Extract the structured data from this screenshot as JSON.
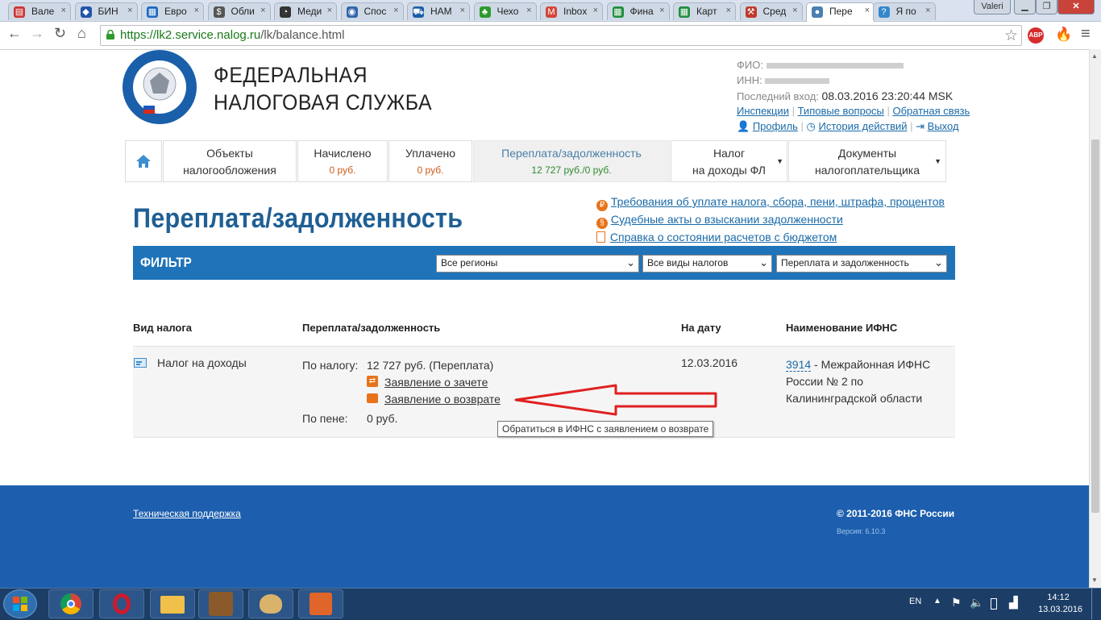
{
  "browser": {
    "tabs": [
      {
        "label": "Вале",
        "icon_color": "#cc3333",
        "icon": "flag-ru"
      },
      {
        "label": "БИН",
        "icon_color": "#2255aa",
        "icon": "diamond"
      },
      {
        "label": "Евро",
        "icon_color": "#1a6ac0",
        "icon": "grid"
      },
      {
        "label": "Обли",
        "icon_color": "#555555",
        "icon": "money"
      },
      {
        "label": "Меди",
        "icon_color": "#333333",
        "icon": "spiral"
      },
      {
        "label": "Спос",
        "icon_color": "#3366aa",
        "icon": "globe"
      },
      {
        "label": "НАМ",
        "icon_color": "#1a5faa",
        "icon": "cart"
      },
      {
        "label": "Чехо",
        "icon_color": "#2e9a2e",
        "icon": "clover"
      },
      {
        "label": "Inbox",
        "icon_color": "#d44638",
        "icon": "gmail"
      },
      {
        "label": "Фина",
        "icon_color": "#1e8e3e",
        "icon": "sheet"
      },
      {
        "label": "Карт",
        "icon_color": "#1e8e3e",
        "icon": "sheet"
      },
      {
        "label": "Сред",
        "icon_color": "#c0392b",
        "icon": "tool"
      },
      {
        "label": "Пере",
        "icon_color": "#4a7fb0",
        "icon": "fns",
        "active": true
      },
      {
        "label": "Я по",
        "icon_color": "#3388cc",
        "icon": "help"
      }
    ],
    "user_badge": "Valeri",
    "url_scheme": "https://",
    "url_host": "lk2.service.nalog.ru",
    "url_path": "/lk/balance.html",
    "abp_label": "ABP"
  },
  "header": {
    "org_line1": "ФЕДЕРАЛЬНАЯ",
    "org_line2": "НАЛОГОВАЯ СЛУЖБА",
    "fio_label": "ФИО:",
    "inn_label": "ИНН:",
    "last_login_label": "Последний вход:",
    "last_login_value": "08.03.2016 23:20:44 MSK",
    "links": [
      "Инспекции",
      "Типовые вопросы",
      "Обратная связь"
    ],
    "profile": "Профиль",
    "history": "История действий",
    "logout": "Выход"
  },
  "nav": [
    {
      "line1": "Объекты",
      "line2": "налогообложения"
    },
    {
      "line1": "Начислено",
      "sub": "0 руб."
    },
    {
      "line1": "Уплачено",
      "sub": "0 руб."
    },
    {
      "line1": "Переплата/задолженность",
      "sub": "12 727 руб./0 руб.",
      "active": true
    },
    {
      "line1": "Налог",
      "line2": "на доходы ФЛ"
    },
    {
      "line1": "Документы",
      "line2": "налогоплательщика"
    }
  ],
  "page": {
    "title": "Переплата/задолженность",
    "side_links": [
      "Требования об уплате налога, сбора, пени, штрафа, процентов",
      "Судебные акты о взыскании задолженности",
      "Справка о состоянии расчетов с бюджетом"
    ],
    "filter_label": "ФИЛЬТР",
    "filter_region": "Все регионы",
    "filter_tax": "Все виды налогов",
    "filter_kind": "Переплата и задолженность"
  },
  "table": {
    "headers": [
      "Вид налога",
      "Переплата/задолженность",
      "На дату",
      "Наименование ИФНС"
    ],
    "row": {
      "tax": "Налог на доходы",
      "by_tax_label": "По налогу:",
      "by_tax_value": "12 727 руб. (Переплата)",
      "offset_link": "Заявление о зачете",
      "refund_link": "Заявление о возврате",
      "penalty_label": "По пене:",
      "penalty_value": "0 руб.",
      "date": "12.03.2016",
      "ifns_code": "3914",
      "ifns_line1": " - Межрайонная ИФНС",
      "ifns_line2": "России № 2 по",
      "ifns_line3": "Калининградской области"
    },
    "tooltip": "Обратиться в ИФНС с заявлением о возврате"
  },
  "footer": {
    "support": "Техническая поддержка",
    "copyright": "© 2011-2016 ФНС России",
    "version": "Версия: 6.10.3"
  },
  "taskbar": {
    "lang": "EN",
    "time": "14:12",
    "date": "13.03.2016"
  }
}
